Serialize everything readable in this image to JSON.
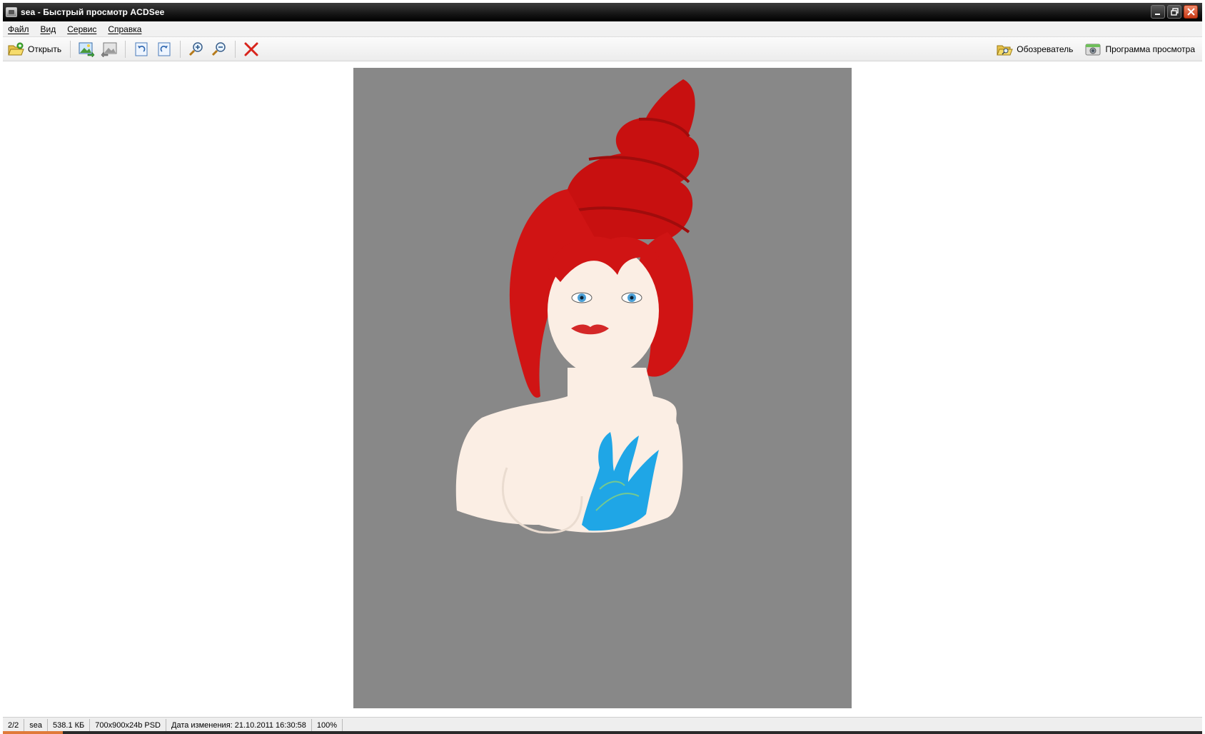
{
  "window": {
    "title": "sea - Быстрый просмотр ACDSee"
  },
  "menu": {
    "items": [
      {
        "label": "Файл"
      },
      {
        "label": "Вид"
      },
      {
        "label": "Сервис"
      },
      {
        "label": "Справка"
      }
    ]
  },
  "toolbar": {
    "open_label": "Открыть",
    "browser_label": "Обозреватель",
    "viewer_label": "Программа просмотра",
    "icons": [
      "open-folder-icon",
      "previous-image-icon",
      "next-image-icon",
      "rotate-left-icon",
      "rotate-right-icon",
      "zoom-in-icon",
      "zoom-out-icon",
      "delete-icon",
      "browser-folder-icon",
      "viewer-camera-icon"
    ]
  },
  "image": {
    "background_color": "#888888",
    "hair_color": "#d01010",
    "skin_color": "#fbeee4",
    "coral_color": "#1fa6e6"
  },
  "statusbar": {
    "position": "2/2",
    "name": "sea",
    "size": "538.1 КБ",
    "dimensions": "700x900x24b PSD",
    "modified": "Дата изменения: 21.10.2011 16:30:58",
    "zoom": "100%"
  }
}
